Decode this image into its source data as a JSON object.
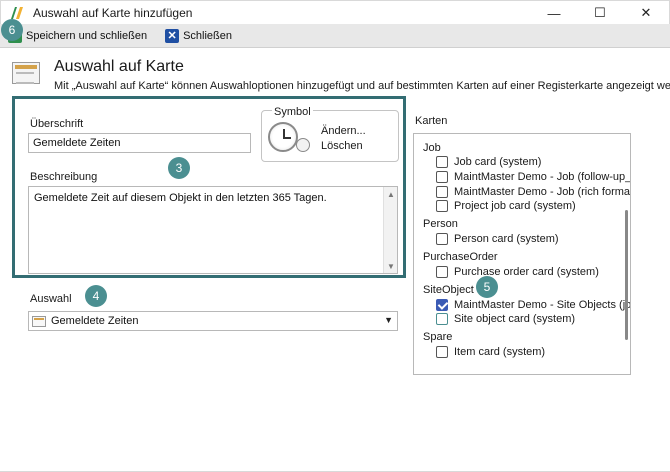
{
  "window": {
    "title": "Auswahl auf Karte hinzufügen",
    "minimize": "—",
    "maximize": "☐",
    "close": "✕"
  },
  "toolbar": {
    "save_label": "Speichern und schließen",
    "close_label": "Schließen",
    "close_glyph": "✕"
  },
  "badges": {
    "b3": "3",
    "b4": "4",
    "b5": "5",
    "b6": "6"
  },
  "header": {
    "title": "Auswahl auf Karte",
    "description": "Mit „Auswahl auf Karte“ können Auswahloptionen hinzugefügt und auf bestimmten Karten auf einer Registerkarte angezeigt werden."
  },
  "form": {
    "heading_label": "Überschrift",
    "heading_value": "Gemeldete Zeiten",
    "symbol_label": "Symbol",
    "symbol_change": "Ändern...",
    "symbol_delete": "Löschen",
    "description_label": "Beschreibung",
    "description_value": "Gemeldete Zeit auf diesem Objekt in den letzten 365 Tagen.",
    "selection_label": "Auswahl",
    "selection_value": "Gemeldete Zeiten",
    "scroll_up": "▲",
    "scroll_down": "▼",
    "select_arrow": "▼"
  },
  "cards": {
    "label": "Karten",
    "groups": [
      {
        "name": "Job",
        "items": [
          {
            "label": "Job card (system)",
            "checked": false
          },
          {
            "label": "MaintMaster Demo - Job (follow-up_",
            "checked": false
          },
          {
            "label": "MaintMaster Demo - Job (rich format",
            "checked": false
          },
          {
            "label": "Project job card (system)",
            "checked": false
          }
        ]
      },
      {
        "name": "Person",
        "items": [
          {
            "label": "Person card (system)",
            "checked": false
          }
        ]
      },
      {
        "name": "PurchaseOrder",
        "items": [
          {
            "label": "Purchase order card (system)",
            "checked": false
          }
        ]
      },
      {
        "name": "SiteObject",
        "items": [
          {
            "label": "MaintMaster Demo - Site Objects (jol",
            "checked": true
          },
          {
            "label": "Site object card (system)",
            "checked": false
          }
        ]
      },
      {
        "name": "Spare",
        "items": [
          {
            "label": "Item card (system)",
            "checked": false
          }
        ]
      }
    ]
  },
  "colors": {
    "accent_teal": "#336d73",
    "badge": "#4b8f91",
    "checked": "#3b5bb5"
  }
}
